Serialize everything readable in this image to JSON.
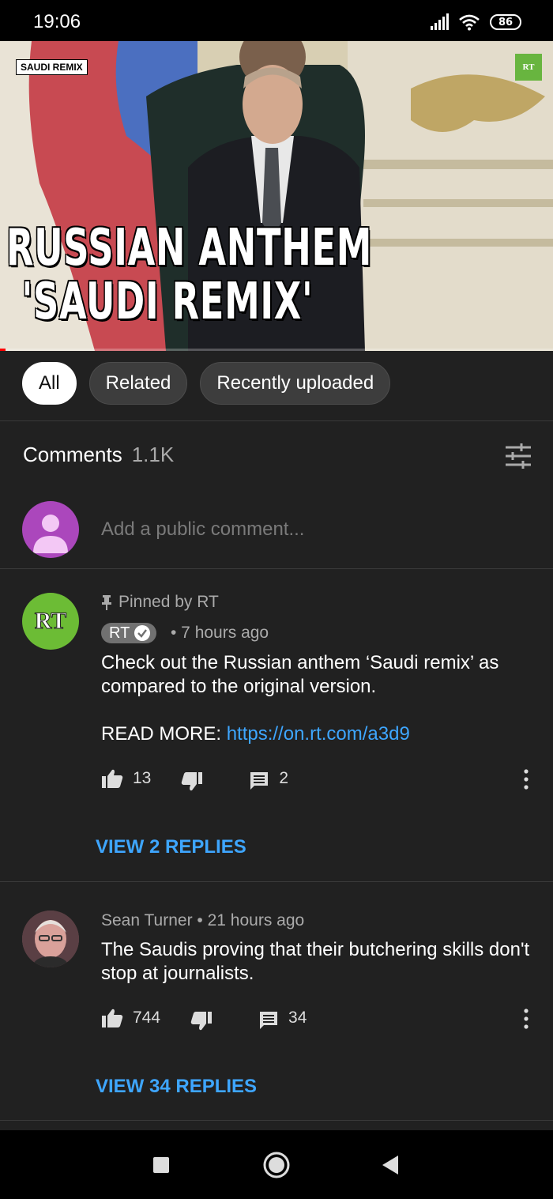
{
  "status_bar": {
    "time": "19:06",
    "battery": "86"
  },
  "video": {
    "overlay_tag": "SAUDI REMIX",
    "channel_badge": "RT",
    "title_line1": "RUSSIAN ANTHEM",
    "title_line2": "'SAUDI REMIX'",
    "progress": 0.01
  },
  "chips": [
    {
      "label": "All",
      "active": true
    },
    {
      "label": "Related",
      "active": false
    },
    {
      "label": "Recently uploaded",
      "active": false
    }
  ],
  "comments_header": {
    "title": "Comments",
    "count": "1.1K"
  },
  "add_comment": {
    "placeholder": "Add a public comment..."
  },
  "comments": [
    {
      "avatar_text": "RT",
      "pinned_label": "Pinned by RT",
      "author": "RT",
      "time": "• 7 hours ago",
      "text_line1": "Check out the Russian anthem ‘Saudi remix’ as compared to the original version.",
      "read_more_label": "READ MORE: ",
      "link": "https://on.rt.com/a3d9",
      "likes": "13",
      "replies_count": "2",
      "view_replies": "VIEW 2 REPLIES"
    },
    {
      "author_meta": "Sean Turner • 21 hours ago",
      "text": "The Saudis proving that their butchering skills don't stop at journalists.",
      "likes": "744",
      "replies_count": "34",
      "view_replies": "VIEW 34 REPLIES"
    }
  ],
  "colors": {
    "background": "#212121",
    "link": "#3ea6ff",
    "rt_green": "#6cbc35",
    "my_avatar": "#ab47bc"
  }
}
